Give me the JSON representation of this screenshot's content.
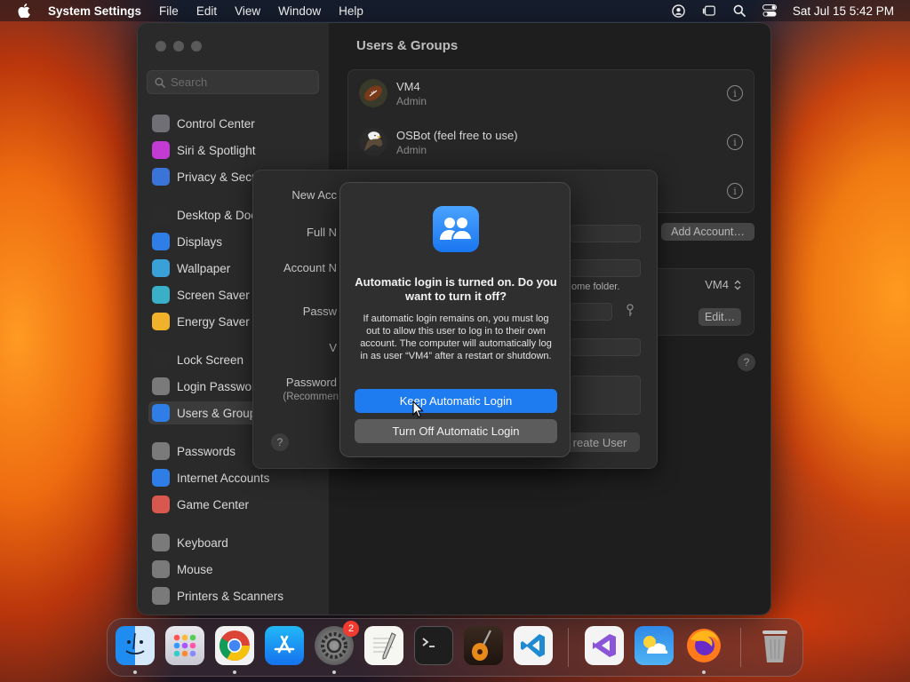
{
  "menubar": {
    "app_name": "System Settings",
    "menus": [
      "File",
      "Edit",
      "View",
      "Window",
      "Help"
    ],
    "clock": "Sat Jul 15  5:42 PM"
  },
  "sidebar": {
    "search_placeholder": "Search",
    "items": [
      {
        "label": "Control Center",
        "icon": "control-center-icon",
        "color": "#6f6f75"
      },
      {
        "label": "Siri & Spotlight",
        "icon": "siri-icon",
        "color": "#c23bd3"
      },
      {
        "label": "Privacy & Security",
        "icon": "hand-icon",
        "color": "#3a74d8"
      },
      {
        "label": "Desktop & Dock",
        "icon": "dock-icon",
        "color": "#2b2b2b"
      },
      {
        "label": "Displays",
        "icon": "sun-icon",
        "color": "#2f7de6"
      },
      {
        "label": "Wallpaper",
        "icon": "wallpaper-icon",
        "color": "#3aa0d8"
      },
      {
        "label": "Screen Saver",
        "icon": "screen-saver-icon",
        "color": "#39b0c8"
      },
      {
        "label": "Energy Saver",
        "icon": "lightbulb-icon",
        "color": "#f0b12b"
      },
      {
        "label": "Lock Screen",
        "icon": "lock-icon",
        "color": "#2b2b2b"
      },
      {
        "label": "Login Password",
        "icon": "lock-icon",
        "color": "#7a7a7a"
      },
      {
        "label": "Users & Groups",
        "icon": "users-icon",
        "color": "#2f7de6",
        "selected": true
      },
      {
        "label": "Passwords",
        "icon": "key-icon",
        "color": "#7a7a7a"
      },
      {
        "label": "Internet Accounts",
        "icon": "at-icon",
        "color": "#2f7de6"
      },
      {
        "label": "Game Center",
        "icon": "game-center-icon",
        "color": "#d8574f"
      },
      {
        "label": "Keyboard",
        "icon": "keyboard-icon",
        "color": "#7a7a7a"
      },
      {
        "label": "Mouse",
        "icon": "mouse-icon",
        "color": "#7a7a7a"
      },
      {
        "label": "Printers & Scanners",
        "icon": "printer-icon",
        "color": "#7a7a7a"
      }
    ]
  },
  "main": {
    "title": "Users & Groups",
    "users": [
      {
        "name": "VM4",
        "role": "Admin",
        "avatar": "football-avatar"
      },
      {
        "name": "OSBot (feel free to use)",
        "role": "Admin",
        "avatar": "eagle-avatar"
      }
    ],
    "add_account_label": "Add Account…",
    "auto_login_value": "VM4",
    "edit_label": "Edit…"
  },
  "sheet": {
    "labels": [
      "New Acc",
      "Full N",
      "Account N",
      "Passw",
      "V",
      "Password",
      "(Recommen"
    ],
    "note": "ome folder.",
    "create_label": "reate User"
  },
  "alert": {
    "title": "Automatic login is turned on. Do you want to turn it off?",
    "body": "If automatic login remains on, you must log out to allow this user to log in to their own account. The computer will automatically log in as user “VM4” after a restart or shutdown.",
    "primary_label": "Keep Automatic Login",
    "secondary_label": "Turn Off Automatic Login"
  },
  "dock": {
    "apps": [
      "Finder",
      "Launchpad",
      "Google Chrome",
      "App Store",
      "System Settings",
      "TextEdit",
      "Terminal",
      "GarageBand",
      "Visual Studio Code",
      "Visual Studio",
      "Weather",
      "Firefox",
      "Trash"
    ],
    "settings_badge": "2"
  },
  "colors": {
    "accent": "#1e7cf0",
    "window_bg": "#1e1e1e",
    "sidebar_bg": "#2a2a2a",
    "badge": "#f23b30"
  }
}
